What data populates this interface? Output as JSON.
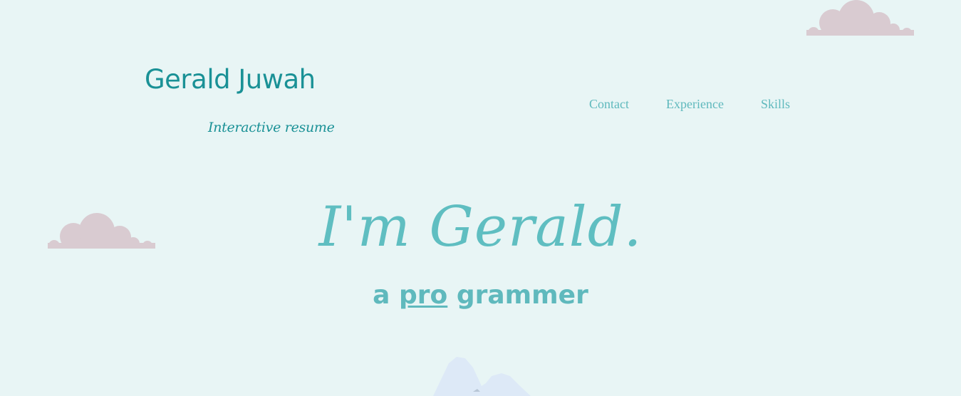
{
  "header": {
    "name": "Gerald Juwah",
    "tagline": "Interactive resume"
  },
  "nav": {
    "items": [
      {
        "label": "Contact"
      },
      {
        "label": "Experience"
      },
      {
        "label": "Skills"
      }
    ]
  },
  "hero": {
    "title": "I'm Gerald.",
    "subtitle_prefix": "a",
    "subtitle_emphasis": "pro",
    "subtitle_suffix": "grammer"
  },
  "colors": {
    "background": "#e8f5f5",
    "brand": "#1a9196",
    "accent": "#5fb9bd",
    "cloud": "#d9cbd1",
    "mountain": "#dde9f7"
  },
  "decorations": {
    "clouds": [
      "cloud-icon",
      "cloud-icon"
    ],
    "mountain": "mountain-icon"
  }
}
